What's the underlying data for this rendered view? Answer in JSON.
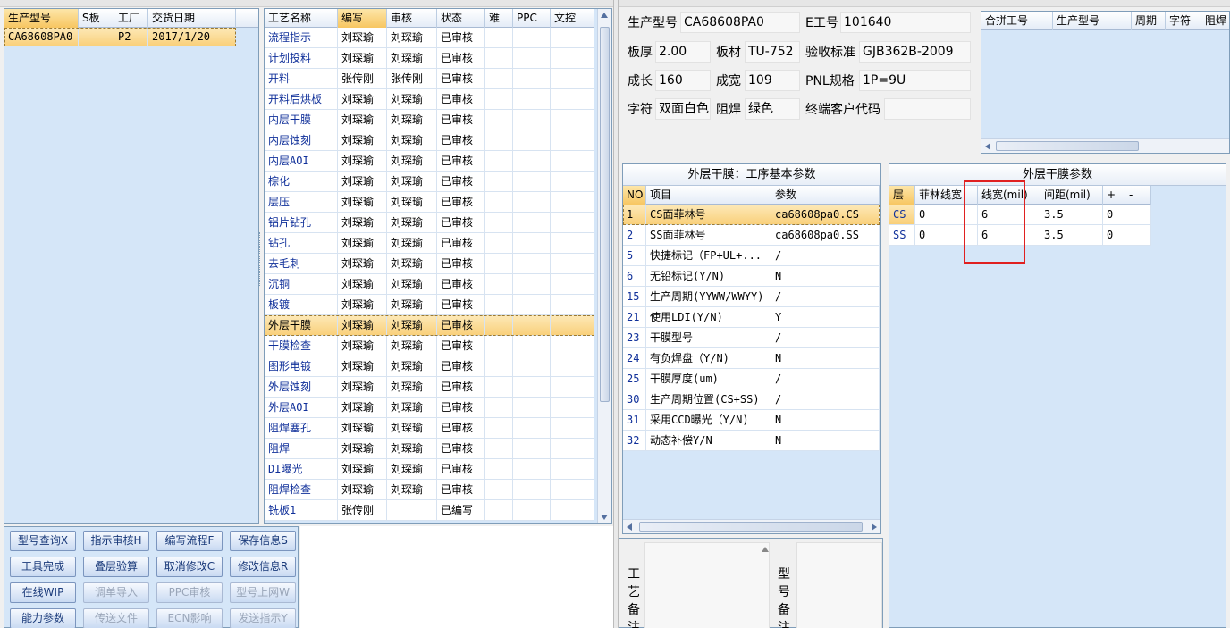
{
  "product_grid": {
    "columns": [
      "生产型号",
      "S板",
      "工厂",
      "交货日期"
    ],
    "rows": [
      [
        "CA68608PA0",
        "",
        "P2",
        "2017/1/20"
      ]
    ]
  },
  "process_grid": {
    "columns": [
      "工艺名称",
      "编写",
      "审核",
      "状态",
      "难",
      "PPC",
      "文控"
    ],
    "rows": [
      [
        "流程指示",
        "刘琛瑜",
        "刘琛瑜",
        "已审核"
      ],
      [
        "计划投料",
        "刘琛瑜",
        "刘琛瑜",
        "已审核"
      ],
      [
        "开料",
        "张传刚",
        "张传刚",
        "已审核"
      ],
      [
        "开料后烘板",
        "刘琛瑜",
        "刘琛瑜",
        "已审核"
      ],
      [
        "内层干膜",
        "刘琛瑜",
        "刘琛瑜",
        "已审核"
      ],
      [
        "内层蚀刻",
        "刘琛瑜",
        "刘琛瑜",
        "已审核"
      ],
      [
        "内层AOI",
        "刘琛瑜",
        "刘琛瑜",
        "已审核"
      ],
      [
        "棕化",
        "刘琛瑜",
        "刘琛瑜",
        "已审核"
      ],
      [
        "层压",
        "刘琛瑜",
        "刘琛瑜",
        "已审核"
      ],
      [
        "铝片钻孔",
        "刘琛瑜",
        "刘琛瑜",
        "已审核"
      ],
      [
        "钻孔",
        "刘琛瑜",
        "刘琛瑜",
        "已审核"
      ],
      [
        "去毛刺",
        "刘琛瑜",
        "刘琛瑜",
        "已审核"
      ],
      [
        "沉铜",
        "刘琛瑜",
        "刘琛瑜",
        "已审核"
      ],
      [
        "板镀",
        "刘琛瑜",
        "刘琛瑜",
        "已审核"
      ],
      [
        "外层干膜",
        "刘琛瑜",
        "刘琛瑜",
        "已审核"
      ],
      [
        "干膜检查",
        "刘琛瑜",
        "刘琛瑜",
        "已审核"
      ],
      [
        "图形电镀",
        "刘琛瑜",
        "刘琛瑜",
        "已审核"
      ],
      [
        "外层蚀刻",
        "刘琛瑜",
        "刘琛瑜",
        "已审核"
      ],
      [
        "外层AOI",
        "刘琛瑜",
        "刘琛瑜",
        "已审核"
      ],
      [
        "阻焊塞孔",
        "刘琛瑜",
        "刘琛瑜",
        "已审核"
      ],
      [
        "阻焊",
        "刘琛瑜",
        "刘琛瑜",
        "已审核"
      ],
      [
        "DI曝光",
        "刘琛瑜",
        "刘琛瑜",
        "已审核"
      ],
      [
        "阻焊检查",
        "刘琛瑜",
        "刘琛瑜",
        "已审核"
      ],
      [
        "铣板1",
        "张传刚",
        "",
        "已编写"
      ]
    ]
  },
  "buttons": [
    {
      "label": "型号查询X",
      "enabled": true
    },
    {
      "label": "指示审核H",
      "enabled": true
    },
    {
      "label": "编写流程F",
      "enabled": true
    },
    {
      "label": "保存信息S",
      "enabled": true
    },
    {
      "label": "工具完成",
      "enabled": true
    },
    {
      "label": "叠层验算",
      "enabled": true
    },
    {
      "label": "取消修改C",
      "enabled": true
    },
    {
      "label": "修改信息R",
      "enabled": true
    },
    {
      "label": "在线WIP",
      "enabled": true
    },
    {
      "label": "调单导入",
      "enabled": false
    },
    {
      "label": "PPC审核",
      "enabled": false
    },
    {
      "label": "型号上网W",
      "enabled": false
    },
    {
      "label": "能力参数",
      "enabled": true
    },
    {
      "label": "传送文件",
      "enabled": false
    },
    {
      "label": "ECN影响",
      "enabled": false
    },
    {
      "label": "发送指示Y",
      "enabled": false
    }
  ],
  "info": {
    "model_label": "生产型号",
    "model_value": "CA68608PA0",
    "eno_label": "E工号",
    "eno_value": "101640",
    "thickness_label": "板厚",
    "thickness_value": "2.00",
    "material_label": "板材",
    "material_value": "TU-752",
    "standard_label": "验收标准",
    "standard_value": "GJB362B-2009",
    "length_label": "成长",
    "length_value": "160",
    "width_label": "成宽",
    "width_value": "109",
    "pnl_label": "PNL规格",
    "pnl_value": "1P=9U",
    "char_label": "字符",
    "char_value": "双面白色",
    "mask_label": "阻焊",
    "mask_value": "绿色",
    "customer_label": "终端客户代码",
    "customer_value": ""
  },
  "merge_grid": {
    "columns": [
      "合拼工号",
      "生产型号",
      "周期",
      "字符",
      "阻焊"
    ]
  },
  "params_panel": {
    "title": "外层干膜：工序基本参数",
    "columns": [
      "NO",
      "项目",
      "参数"
    ],
    "rows": [
      [
        "1",
        "CS面菲林号",
        "ca68608pa0.CS"
      ],
      [
        "2",
        "SS面菲林号",
        "ca68608pa0.SS"
      ],
      [
        "5",
        "快捷标记（FP+UL+...",
        "/"
      ],
      [
        "6",
        "无铅标记(Y/N)",
        "N"
      ],
      [
        "15",
        "生产周期(YYWW/WWYY)",
        "/"
      ],
      [
        "21",
        "使用LDI(Y/N)",
        "Y"
      ],
      [
        "23",
        "干膜型号",
        "/"
      ],
      [
        "24",
        "有负焊盘（Y/N)",
        "N"
      ],
      [
        "25",
        "干膜厚度(um)",
        "/"
      ],
      [
        "30",
        "生产周期位置(CS+SS)",
        "/"
      ],
      [
        "31",
        "采用CCD曝光（Y/N)",
        "N"
      ],
      [
        "32",
        "动态补偿Y/N",
        "N"
      ]
    ]
  },
  "film_panel": {
    "title": "外层干膜参数",
    "columns": [
      "层",
      "菲林线宽",
      "线宽(mil)",
      "间距(mil)",
      "+",
      "-"
    ],
    "rows": [
      [
        "CS",
        "0",
        "6",
        "3.5",
        "0",
        ""
      ],
      [
        "SS",
        "0",
        "6",
        "3.5",
        "0",
        ""
      ]
    ]
  },
  "remarks": {
    "process_label": "工艺备注",
    "model_label": "型号备注"
  },
  "colors": {
    "grid_bg": "#d5e6f8",
    "selected_row": "#f9cf78",
    "highlight_box": "#e02020"
  }
}
